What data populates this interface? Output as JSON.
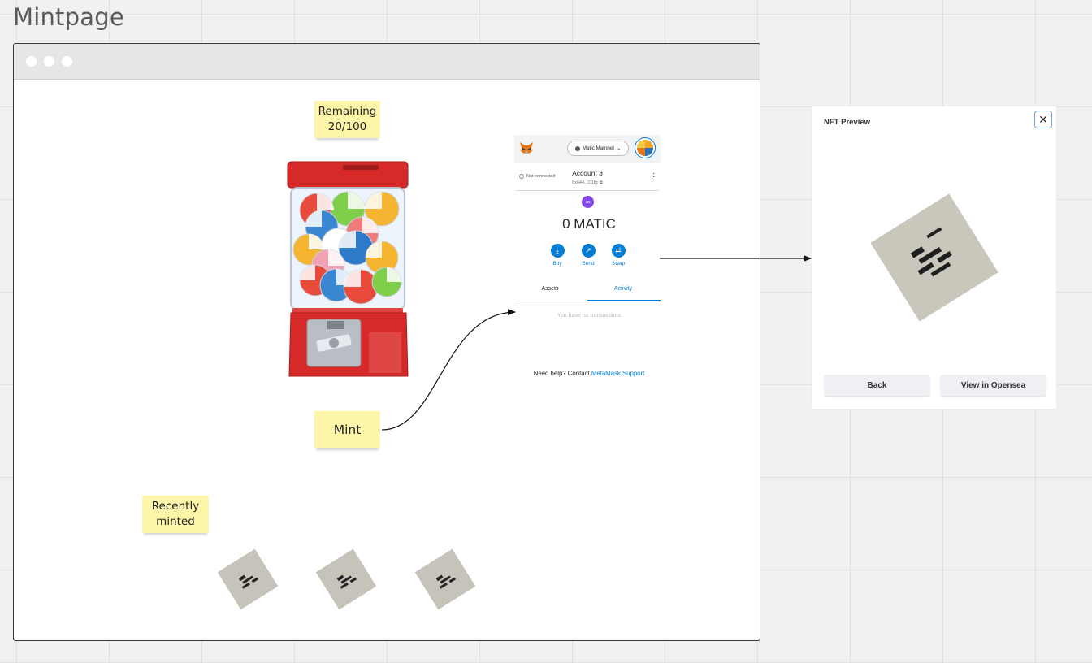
{
  "board": {
    "title": "Mintpage"
  },
  "stickies": {
    "remaining_label": "Remaining",
    "remaining_value": "20/100",
    "mint": "Mint",
    "recent_line1": "Recently",
    "recent_line2": "minted"
  },
  "metamask": {
    "network": "Matic Mainnet",
    "connection_status": "Not connected",
    "account_name": "Account 3",
    "account_address": "0x644...C1bc",
    "balance": "0 MATIC",
    "actions": [
      "Buy",
      "Send",
      "Swap"
    ],
    "tabs": [
      "Assets",
      "Activity"
    ],
    "active_tab": "Activity",
    "empty_message": "You have no transactions",
    "help_text": "Need help? Contact",
    "help_link": "MetaMask Support"
  },
  "preview": {
    "title": "NFT Preview",
    "back_label": "Back",
    "opensea_label": "View in Opensea"
  },
  "icons": {
    "fox": "metamask-fox-icon",
    "close": "close-icon",
    "buy": "download-icon",
    "send": "arrow-up-right-icon",
    "swap": "swap-icon",
    "token": "polygon-icon"
  },
  "colors": {
    "sticky": "#fdf5a8",
    "metamask_blue": "#037dd6",
    "polygon_purple": "#8247e5",
    "gumball_red": "#d62a2a"
  }
}
